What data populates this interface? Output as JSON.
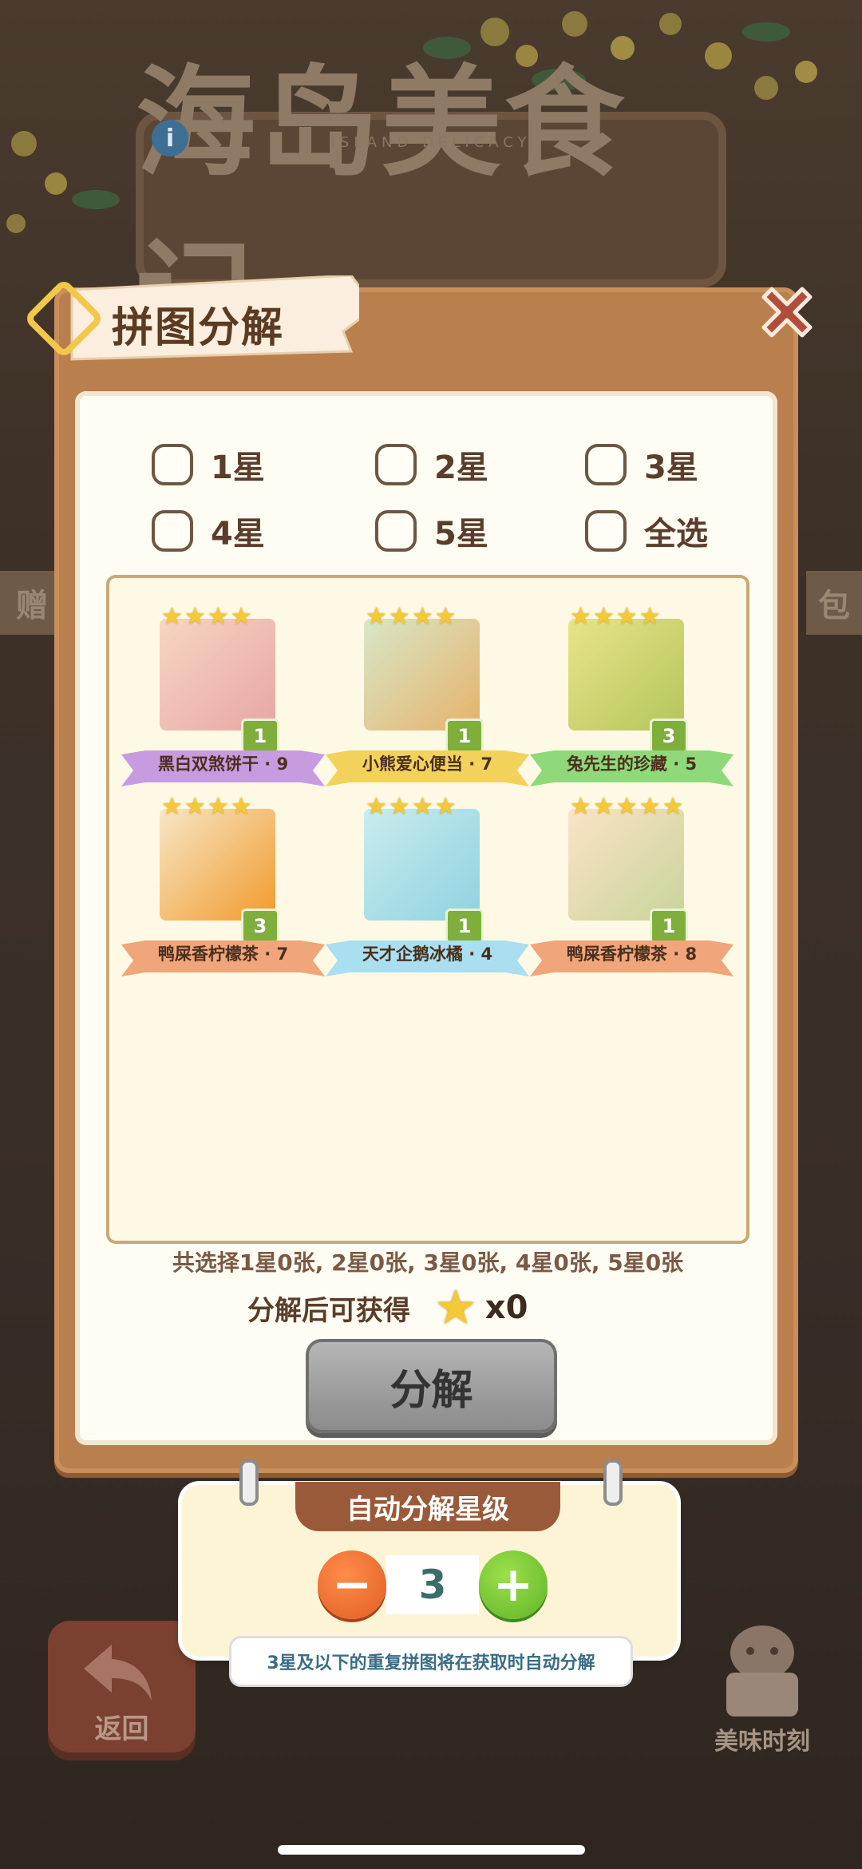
{
  "background": {
    "title": "海岛美食记",
    "subtitle": "ISLAND DELICACY",
    "left_band_text": "赠",
    "right_band_text": "包",
    "back_label": "返回",
    "moment_label": "美味时刻"
  },
  "dialog": {
    "title": "拼图分解",
    "filters": [
      {
        "label": "1星",
        "checked": false
      },
      {
        "label": "2星",
        "checked": false
      },
      {
        "label": "3星",
        "checked": false
      },
      {
        "label": "4星",
        "checked": false
      },
      {
        "label": "5星",
        "checked": false
      },
      {
        "label": "全选",
        "checked": false
      }
    ],
    "cards": [
      {
        "name": "黑白双煞饼干 · 9",
        "stars": 4,
        "count": "1",
        "banner_color": "#c79be0",
        "img_a": "#f6d6c2",
        "img_b": "#e8a6a4"
      },
      {
        "name": "小熊爱心便当 · 7",
        "stars": 4,
        "count": "1",
        "banner_color": "#f2d25a",
        "img_a": "#d8e7c8",
        "img_b": "#e6b26a"
      },
      {
        "name": "兔先生的珍藏 · 5",
        "stars": 4,
        "count": "3",
        "banner_color": "#8fd97a",
        "img_a": "#e8e48a",
        "img_b": "#b4c55a"
      },
      {
        "name": "鸭屎香柠檬茶 · 7",
        "stars": 4,
        "count": "3",
        "banner_color": "#f0a57a",
        "img_a": "#f6e6c6",
        "img_b": "#f29a2a"
      },
      {
        "name": "天才企鹅冰橘 · 4",
        "stars": 4,
        "count": "1",
        "banner_color": "#a9dff0",
        "img_a": "#c9ecef",
        "img_b": "#8fd2e0"
      },
      {
        "name": "鸭屎香柠檬茶 · 8",
        "stars": 5,
        "count": "1",
        "banner_color": "#f0a57a",
        "img_a": "#fbe3c7",
        "img_b": "#c9d49a"
      }
    ],
    "summary": "共选择1星0张, 2星0张, 3星0张, 4星0张, 5星0张",
    "reward_label": "分解后可获得",
    "reward_count": "x0",
    "decompose_label": "分解"
  },
  "auto_decompose": {
    "title": "自动分解星级",
    "level": "3",
    "tooltip": "3星及以下的重复拼图将在获取时自动分解"
  }
}
